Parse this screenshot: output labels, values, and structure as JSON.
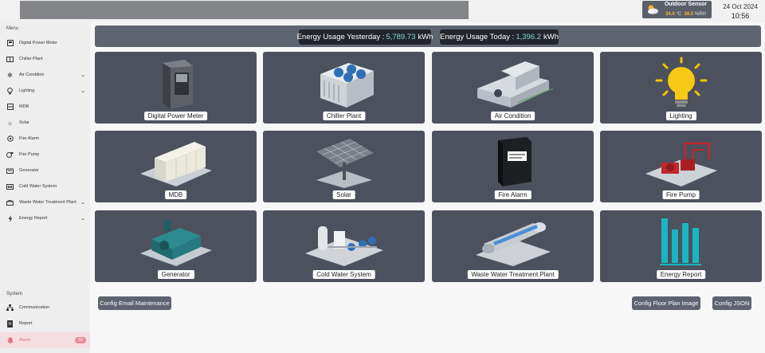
{
  "header": {
    "sensor": {
      "title": "Outdoor Sensor",
      "temp": "34.0",
      "temp_unit": "°C",
      "humidity": "38.5",
      "humidity_unit": "%RH",
      "icon": "partly-cloudy-icon"
    },
    "date": "24 Oct 2024",
    "time": "10:56"
  },
  "sidebar": {
    "menu_label": "Menu",
    "items": [
      {
        "label": "Digital Power Meter",
        "icon": "power-meter-icon",
        "expandable": false
      },
      {
        "label": "Chiller Plant",
        "icon": "chiller-icon",
        "expandable": false
      },
      {
        "label": "Air Condition",
        "icon": "fan-icon",
        "expandable": true
      },
      {
        "label": "Lighting",
        "icon": "bulb-icon",
        "expandable": true
      },
      {
        "label": "MDB",
        "icon": "mdb-icon",
        "expandable": false
      },
      {
        "label": "Solar",
        "icon": "sun-icon",
        "expandable": false
      },
      {
        "label": "Fire Alarm",
        "icon": "fire-alarm-icon",
        "expandable": false
      },
      {
        "label": "Fire Pump",
        "icon": "fire-pump-icon",
        "expandable": false
      },
      {
        "label": "Generator",
        "icon": "generator-icon",
        "expandable": false
      },
      {
        "label": "Cold Water System",
        "icon": "water-system-icon",
        "expandable": false
      },
      {
        "label": "Waste Water Treatment Plant",
        "icon": "water-plant-icon",
        "expandable": true
      },
      {
        "label": "Energy Report",
        "icon": "lightning-icon",
        "expandable": true
      }
    ],
    "system_label": "System",
    "system_items": [
      {
        "label": "Communication",
        "icon": "network-icon"
      },
      {
        "label": "Report",
        "icon": "report-icon"
      },
      {
        "label": "Alarm",
        "icon": "bell-icon",
        "badge": "56"
      }
    ]
  },
  "energy": {
    "yesterday_label": "Energy Usage Yesterday :",
    "yesterday_value": "5,789.73",
    "today_label": "Energy Usage Today :",
    "today_value": "1,396.2",
    "unit": "kWh"
  },
  "cards": [
    {
      "label": "Digital Power Meter"
    },
    {
      "label": "Chiller Plant"
    },
    {
      "label": "Air Condition"
    },
    {
      "label": "Lighting"
    },
    {
      "label": "MDB"
    },
    {
      "label": "Solar"
    },
    {
      "label": "Fire Alarm"
    },
    {
      "label": "Fire Pump"
    },
    {
      "label": "Generator"
    },
    {
      "label": "Cold Water System"
    },
    {
      "label": "Waste Water Treatment Plant"
    },
    {
      "label": "Energy Report"
    }
  ],
  "buttons": {
    "email": "Config Email Maintenance",
    "floor_plan": "Config Floor Plan Image",
    "json": "Config JSON"
  },
  "colors": {
    "accent_value": "#7fd9cf",
    "card_bg": "#4c515d",
    "alarm_badge": "#e58a95"
  }
}
